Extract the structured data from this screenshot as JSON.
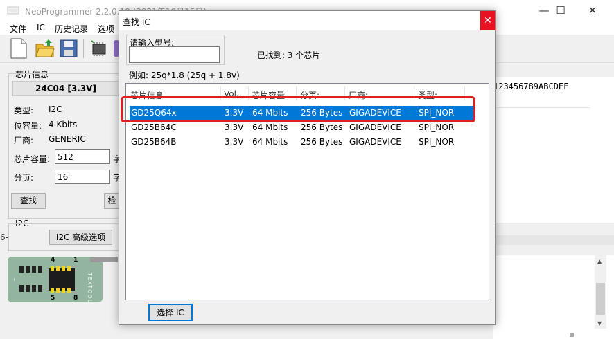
{
  "main": {
    "title": "NeoProgrammer 2.2.0.10 (2021年10月15日)",
    "window_controls": [
      "—",
      "☐",
      "✕"
    ],
    "menu": [
      "文件",
      "IC",
      "历史记录",
      "选项"
    ],
    "hex_header": "123456789ABCDEF",
    "chip_info": {
      "group_label": "芯片信息",
      "chip_name": "24C04 [3.3V]",
      "type_label": "类型:",
      "type_value": "I2C",
      "bits_label": "位容量:",
      "bits_value": "4 Kbits",
      "vendor_label": "厂商:",
      "vendor_value": "GENERIC",
      "capacity_label": "芯片容量:",
      "capacity_value": "512",
      "capacity_unit": "字",
      "page_label": "分页:",
      "page_value": "16",
      "page_unit": "字",
      "find_button": "查找",
      "check_button": "检"
    },
    "i2c": {
      "group_label": "I2C",
      "advanced_button": "I2C 高级选项",
      "edge_text": "6-"
    },
    "socket": {
      "pin_top_left": "4",
      "pin_top_right": "1",
      "pin_bottom_left": "5",
      "pin_bottom_right": "8",
      "brand": "TEXTOOL"
    }
  },
  "dialog": {
    "title": "查找 IC",
    "close": "✕",
    "input_label": "请输入型号:",
    "input_value": "",
    "found_text": "已找到: 3 个芯片",
    "example_text": "例如:   25q*1.8 (25q + 1.8v)",
    "columns": [
      "芯片信息",
      "Vol...",
      "芯片容量...",
      "分页:",
      "厂商:",
      "类型:"
    ],
    "rows": [
      [
        "GD25Q64x",
        "3.3V",
        "64 Mbits",
        "256 Bytes",
        "GIGADEVICE",
        "SPI_NOR"
      ],
      [
        "GD25B64C",
        "3.3V",
        "64 Mbits",
        "256 Bytes",
        "GIGADEVICE",
        "SPI_NOR"
      ],
      [
        "GD25B64B",
        "3.3V",
        "64 Mbits",
        "256 Bytes",
        "GIGADEVICE",
        "SPI_NOR"
      ]
    ],
    "selected_row": 0,
    "select_button": "选择 IC",
    "colors": {
      "selection": "#0078d7",
      "highlight": "#e02020",
      "close_bg": "#e81123"
    }
  }
}
